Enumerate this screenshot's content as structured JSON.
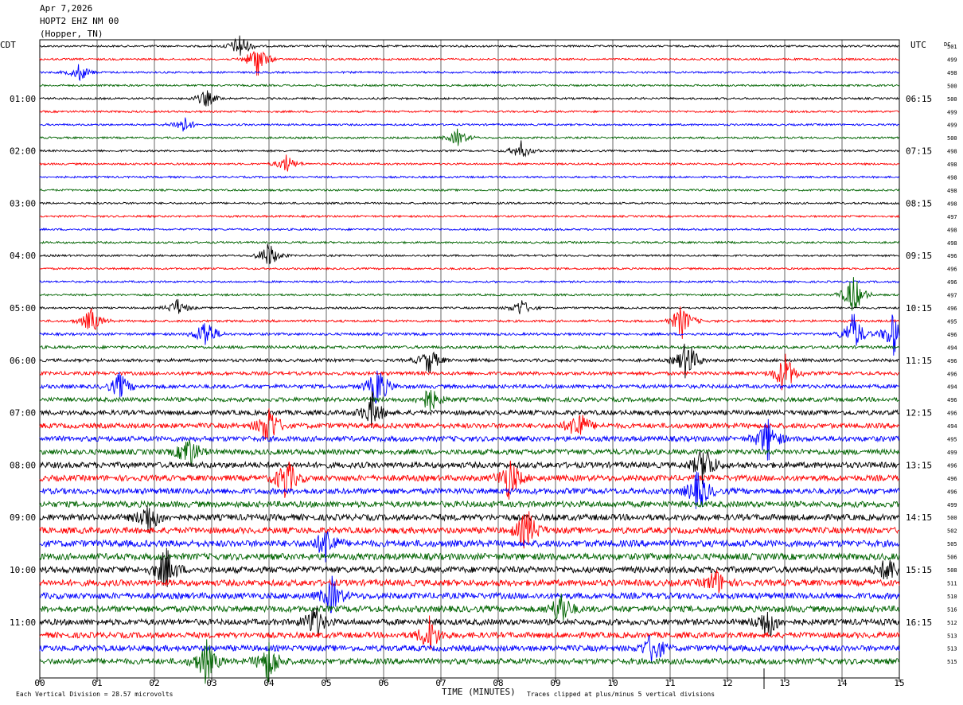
{
  "header": {
    "date": "Apr 7,2026",
    "station": "HOPT2 EHZ NM 00",
    "location": "(Hopper, TN)"
  },
  "labels": {
    "left_tz": "CDT",
    "right_tz": "UTC",
    "dc": "DC",
    "xlabel": "TIME (MINUTES)",
    "scale_note": "Each Vertical Division =   28.57 microvolts",
    "clip_note": "Traces clipped at plus/minus 5 vertical divisions"
  },
  "chart_data": {
    "type": "line",
    "title": "HOPT2 EHZ NM 00 (Hopper, TN)",
    "xlabel": "TIME (MINUTES)",
    "xlim": [
      0,
      15
    ],
    "x_ticks": [
      "00",
      "01",
      "02",
      "03",
      "04",
      "05",
      "06",
      "07",
      "08",
      "09",
      "10",
      "11",
      "12",
      "13",
      "14",
      "15"
    ],
    "rows_per_hour": 4,
    "trace_colors": [
      "#000000",
      "#ff0000",
      "#0000ff",
      "#006400"
    ],
    "left_hour_labels": [
      "01:00",
      "02:00",
      "03:00",
      "04:00",
      "05:00",
      "06:00",
      "07:00",
      "08:00",
      "09:00",
      "10:00",
      "11:00"
    ],
    "right_hour_labels": [
      "06:15",
      "07:15",
      "08:15",
      "09:15",
      "10:15",
      "11:15",
      "12:15",
      "13:15",
      "14:15",
      "15:15",
      "16:15"
    ],
    "dc_offsets": [
      501,
      499,
      498,
      500,
      500,
      499,
      499,
      500,
      498,
      498,
      498,
      498,
      498,
      497,
      498,
      498,
      496,
      496,
      496,
      497,
      496,
      495,
      496,
      494,
      496,
      496,
      494,
      496,
      496,
      494,
      495,
      499,
      496,
      496,
      496,
      499,
      500,
      502,
      505,
      506,
      508,
      511,
      510,
      516,
      512,
      513,
      513,
      515
    ],
    "amplitude_profile": [
      1,
      1,
      1,
      1,
      1,
      1,
      1,
      1,
      1,
      1,
      1,
      1,
      1,
      1,
      1,
      1,
      1,
      1,
      1,
      1,
      1,
      1.2,
      1.3,
      1.5,
      1.6,
      1.8,
      2.0,
      2.2,
      2.5,
      2.6,
      2.7,
      2.8,
      3.0,
      3.0,
      3.0,
      3.1,
      3.2,
      3.2,
      3.4,
      3.4,
      3.3,
      3.2,
      3.2,
      3.2,
      3.1,
      3.0,
      3.0,
      3.0
    ],
    "events": [
      {
        "row": 0,
        "minute": 3.5,
        "amp": 3
      },
      {
        "row": 1,
        "minute": 3.8,
        "amp": 4
      },
      {
        "row": 2,
        "minute": 0.7,
        "amp": 2
      },
      {
        "row": 4,
        "minute": 2.9,
        "amp": 2
      },
      {
        "row": 6,
        "minute": 2.5,
        "amp": 2
      },
      {
        "row": 7,
        "minute": 7.3,
        "amp": 2
      },
      {
        "row": 8,
        "minute": 8.4,
        "amp": 2
      },
      {
        "row": 9,
        "minute": 4.3,
        "amp": 2
      },
      {
        "row": 16,
        "minute": 4.0,
        "amp": 3
      },
      {
        "row": 19,
        "minute": 14.2,
        "amp": 5
      },
      {
        "row": 20,
        "minute": 2.4,
        "amp": 2
      },
      {
        "row": 20,
        "minute": 8.4,
        "amp": 2
      },
      {
        "row": 21,
        "minute": 0.9,
        "amp": 3
      },
      {
        "row": 21,
        "minute": 11.2,
        "amp": 4
      },
      {
        "row": 22,
        "minute": 2.9,
        "amp": 4
      },
      {
        "row": 22,
        "minute": 14.2,
        "amp": 5
      },
      {
        "row": 22,
        "minute": 14.9,
        "amp": 5
      },
      {
        "row": 24,
        "minute": 11.3,
        "amp": 5
      },
      {
        "row": 24,
        "minute": 6.8,
        "amp": 3
      },
      {
        "row": 25,
        "minute": 13.0,
        "amp": 5
      },
      {
        "row": 26,
        "minute": 1.4,
        "amp": 3
      },
      {
        "row": 26,
        "minute": 5.9,
        "amp": 5
      },
      {
        "row": 27,
        "minute": 6.8,
        "amp": 3
      },
      {
        "row": 28,
        "minute": 5.8,
        "amp": 4
      },
      {
        "row": 29,
        "minute": 4.0,
        "amp": 5
      },
      {
        "row": 29,
        "minute": 9.4,
        "amp": 4
      },
      {
        "row": 30,
        "minute": 12.7,
        "amp": 5
      },
      {
        "row": 31,
        "minute": 2.6,
        "amp": 4
      },
      {
        "row": 32,
        "minute": 11.6,
        "amp": 5
      },
      {
        "row": 33,
        "minute": 4.3,
        "amp": 5
      },
      {
        "row": 33,
        "minute": 8.2,
        "amp": 5
      },
      {
        "row": 34,
        "minute": 11.5,
        "amp": 5
      },
      {
        "row": 36,
        "minute": 1.9,
        "amp": 4
      },
      {
        "row": 37,
        "minute": 8.5,
        "amp": 5
      },
      {
        "row": 38,
        "minute": 5.0,
        "amp": 4
      },
      {
        "row": 40,
        "minute": 2.2,
        "amp": 5
      },
      {
        "row": 40,
        "minute": 14.8,
        "amp": 3
      },
      {
        "row": 41,
        "minute": 11.8,
        "amp": 3
      },
      {
        "row": 42,
        "minute": 5.1,
        "amp": 4
      },
      {
        "row": 43,
        "minute": 9.1,
        "amp": 4
      },
      {
        "row": 44,
        "minute": 4.8,
        "amp": 4
      },
      {
        "row": 44,
        "minute": 12.7,
        "amp": 4
      },
      {
        "row": 45,
        "minute": 6.8,
        "amp": 4
      },
      {
        "row": 46,
        "minute": 10.7,
        "amp": 4
      },
      {
        "row": 47,
        "minute": 2.9,
        "amp": 5
      },
      {
        "row": 47,
        "minute": 4.0,
        "amp": 5
      }
    ]
  }
}
